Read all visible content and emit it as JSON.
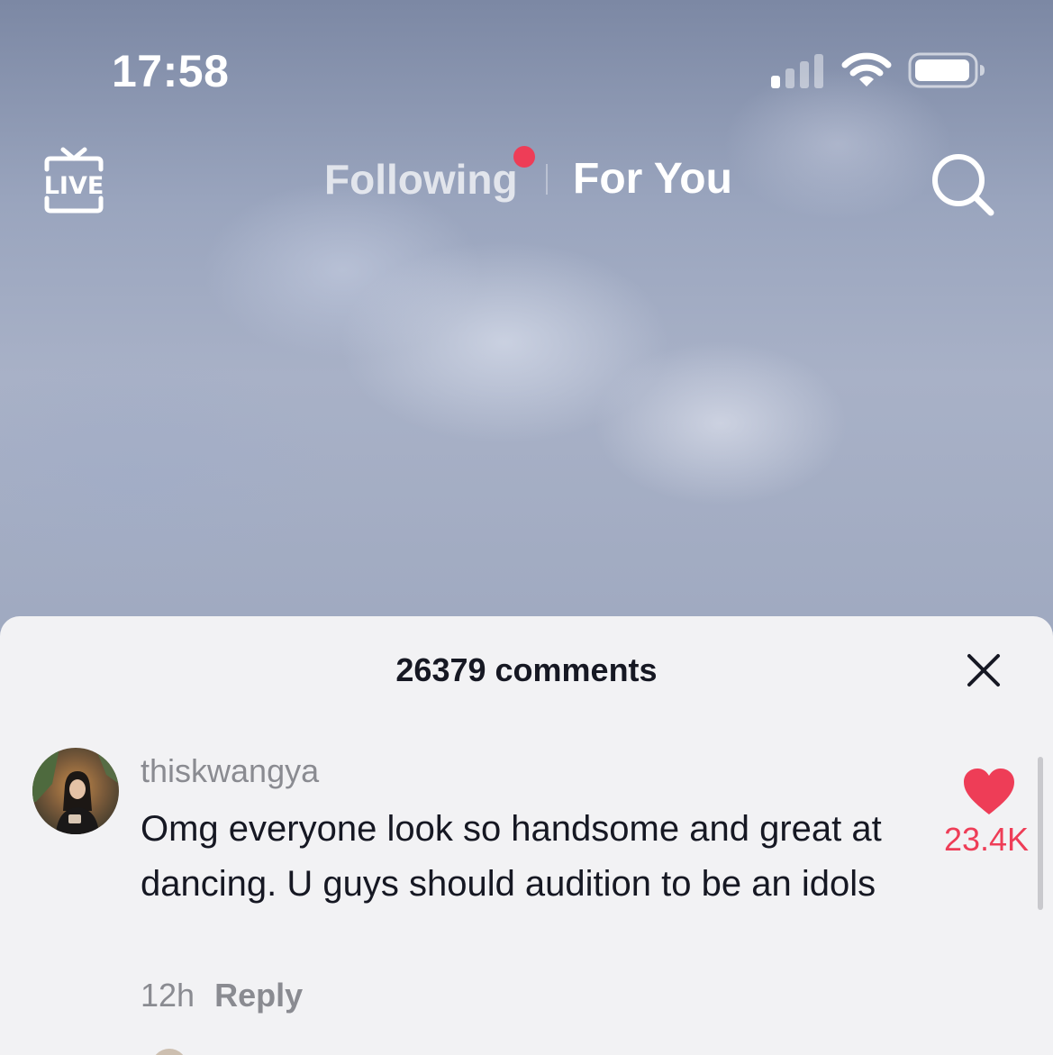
{
  "status_bar": {
    "time": "17:58",
    "icons": [
      "cellular-signal-icon",
      "wifi-icon",
      "battery-icon"
    ]
  },
  "top_nav": {
    "live_label": "LIVE",
    "tabs": [
      {
        "label": "Following",
        "active": false,
        "has_badge": true
      },
      {
        "label": "For You",
        "active": true
      }
    ],
    "search_icon": "search-icon"
  },
  "comments_sheet": {
    "title": "26379 comments",
    "close_icon": "close-icon",
    "comments": [
      {
        "username": "thiskwangya",
        "text": "Omg everyone look so handsome and great at dancing. U guys should audition to be an idols",
        "time": "12h",
        "reply_label": "Reply",
        "likes": "23.4K",
        "liked": true
      }
    ]
  },
  "colors": {
    "accent": "#ee3d57",
    "sheet_bg": "#f2f2f4",
    "text_primary": "#161823",
    "text_secondary": "#8a8b91"
  }
}
